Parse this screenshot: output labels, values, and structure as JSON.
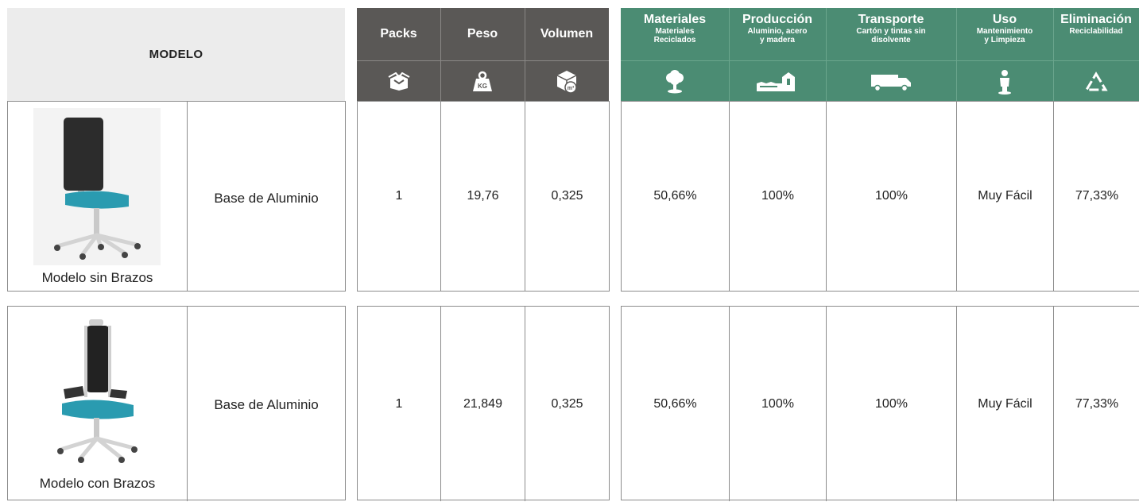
{
  "model_header": "MODELO",
  "metrics_headers": [
    {
      "label": "Packs",
      "icon": "box-icon"
    },
    {
      "label": "Peso",
      "icon": "weight-icon"
    },
    {
      "label": "Volumen",
      "icon": "volume-cube-icon"
    }
  ],
  "eco_headers": [
    {
      "title": "Materiales",
      "sub": "Materiales\nReciclados",
      "sub_bold": true,
      "icon": "tree-icon"
    },
    {
      "title": "Producción",
      "sub": "Aluminio, acero\ny madera",
      "sub_bold": true,
      "icon": "factory-icon"
    },
    {
      "title": "Transporte",
      "sub": "Cartón y tintas sin",
      "sub2": "disolvente",
      "sub_bold": false,
      "icon": "truck-icon"
    },
    {
      "title": "Uso",
      "sub": "Mantenimiento\ny Limpieza",
      "sub_bold": true,
      "icon": "person-icon"
    },
    {
      "title": "Eliminación",
      "sub": "Reciclabilidad",
      "sub_bold": true,
      "icon": "recycle-icon"
    }
  ],
  "rows": [
    {
      "caption": "Modelo sin Brazos",
      "variant": "Base de Aluminio",
      "packs": "1",
      "peso": "19,76",
      "volumen": "0,325",
      "materiales": "50,66%",
      "produccion": "100%",
      "transporte": "100%",
      "uso": "Muy Fácil",
      "eliminacion": "77,33%"
    },
    {
      "caption": "Modelo con Brazos",
      "variant": "Base de Aluminio",
      "packs": "1",
      "peso": "21,849",
      "volumen": "0,325",
      "materiales": "50,66%",
      "produccion": "100%",
      "transporte": "100%",
      "uso": "Muy Fácil",
      "eliminacion": "77,33%"
    }
  ],
  "colors": {
    "gray_header": "#5a5856",
    "green_header": "#4b8c73",
    "model_header_bg": "#ececec",
    "seat": "#2a9bb0"
  }
}
